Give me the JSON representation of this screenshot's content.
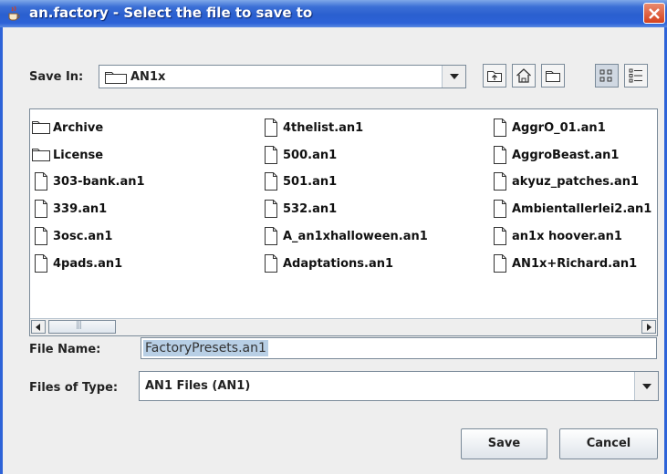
{
  "window": {
    "title": "an.factory - Select the file to save to"
  },
  "save_in": {
    "label": "Save In:",
    "value": "AN1x"
  },
  "toolbar": {
    "icons": [
      "up-folder-icon",
      "home-icon",
      "new-folder-icon",
      "list-view-icon",
      "details-view-icon"
    ],
    "selected": "list-view-icon"
  },
  "files": {
    "columns": [
      [
        {
          "name": "Archive",
          "type": "folder"
        },
        {
          "name": "License",
          "type": "folder"
        },
        {
          "name": "303-bank.an1",
          "type": "file"
        },
        {
          "name": "339.an1",
          "type": "file"
        },
        {
          "name": "3osc.an1",
          "type": "file"
        },
        {
          "name": "4pads.an1",
          "type": "file"
        }
      ],
      [
        {
          "name": "4thelist.an1",
          "type": "file"
        },
        {
          "name": "500.an1",
          "type": "file"
        },
        {
          "name": "501.an1",
          "type": "file"
        },
        {
          "name": "532.an1",
          "type": "file"
        },
        {
          "name": "A_an1xhalloween.an1",
          "type": "file"
        },
        {
          "name": "Adaptations.an1",
          "type": "file"
        }
      ],
      [
        {
          "name": "AggrO_01.an1",
          "type": "file"
        },
        {
          "name": "AggroBeast.an1",
          "type": "file"
        },
        {
          "name": "akyuz_patches.an1",
          "type": "file"
        },
        {
          "name": "Ambientallerlei2.an1",
          "type": "file"
        },
        {
          "name": "an1x hoover.an1",
          "type": "file"
        },
        {
          "name": "AN1x+Richard.an1",
          "type": "file"
        }
      ]
    ]
  },
  "file_name": {
    "label": "File Name:",
    "value": "FactoryPresets.an1"
  },
  "file_type": {
    "label": "Files of Type:",
    "value": "AN1 Files (AN1)"
  },
  "buttons": {
    "save": "Save",
    "cancel": "Cancel"
  },
  "colors": {
    "titlebar": "#2a5fcf",
    "close": "#d5421e",
    "selection": "#b8cfe5"
  }
}
